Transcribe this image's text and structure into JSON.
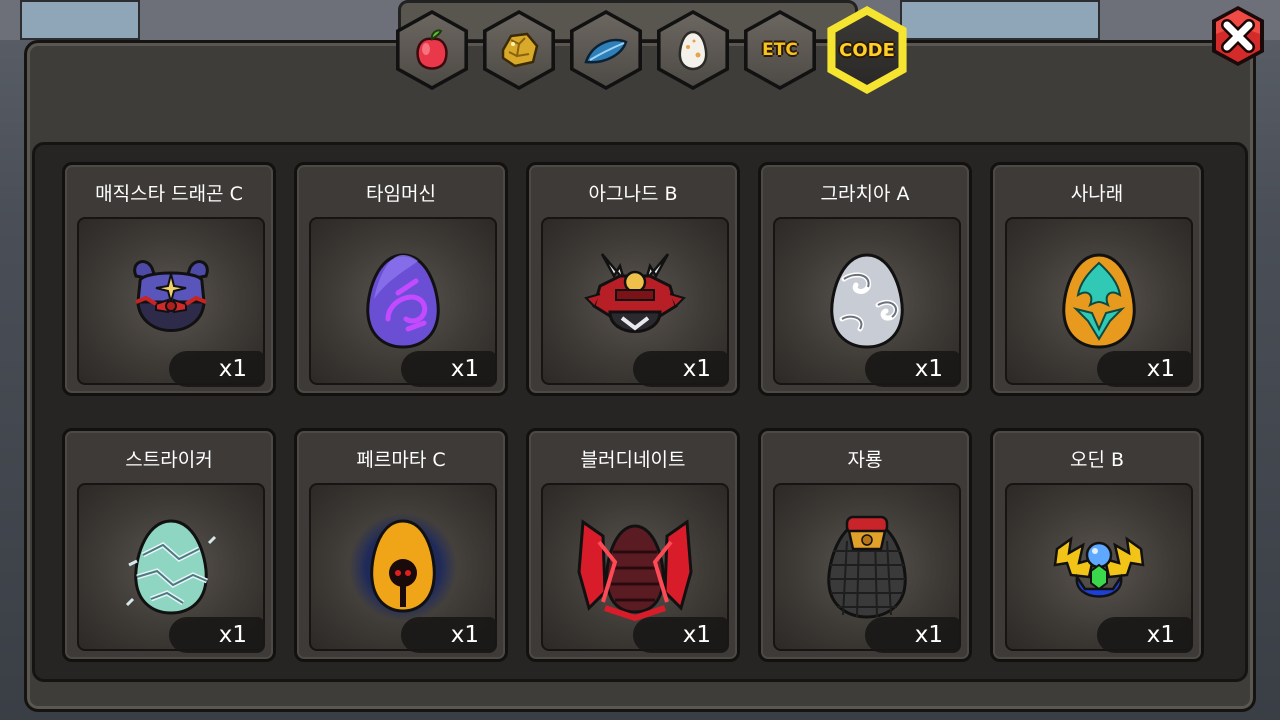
{
  "tabs": [
    {
      "id": "fruit",
      "icon": "fruit-icon",
      "label": ""
    },
    {
      "id": "ore",
      "icon": "gold-ore-icon",
      "label": ""
    },
    {
      "id": "feather",
      "icon": "blue-feather-icon",
      "label": ""
    },
    {
      "id": "egg",
      "icon": "egg-icon",
      "label": ""
    },
    {
      "id": "etc",
      "icon": "",
      "label": "ETC"
    },
    {
      "id": "code",
      "icon": "",
      "label": "CODE",
      "active": true
    }
  ],
  "colors": {
    "active_tab_outline": "#f5e531",
    "tab_text": "#f7c41f",
    "close_button": "#d32a2a"
  },
  "items": [
    {
      "name": "매직스타 드래곤 C",
      "qty": "x1",
      "icon": "magic-star-dragon-egg-icon"
    },
    {
      "name": "타임머신",
      "qty": "x1",
      "icon": "time-machine-egg-icon"
    },
    {
      "name": "아그나드 B",
      "qty": "x1",
      "icon": "agnad-egg-icon"
    },
    {
      "name": "그라치아 A",
      "qty": "x1",
      "icon": "grazia-egg-icon"
    },
    {
      "name": "사나래",
      "qty": "x1",
      "icon": "sanarae-egg-icon"
    },
    {
      "name": "스트라이커",
      "qty": "x1",
      "icon": "striker-egg-icon"
    },
    {
      "name": "페르마타 C",
      "qty": "x1",
      "icon": "fermata-egg-icon"
    },
    {
      "name": "블러디네이트",
      "qty": "x1",
      "icon": "bloodynate-egg-icon"
    },
    {
      "name": "자룡",
      "qty": "x1",
      "icon": "jaryong-egg-icon"
    },
    {
      "name": "오딘 B",
      "qty": "x1",
      "icon": "odin-egg-icon"
    }
  ]
}
